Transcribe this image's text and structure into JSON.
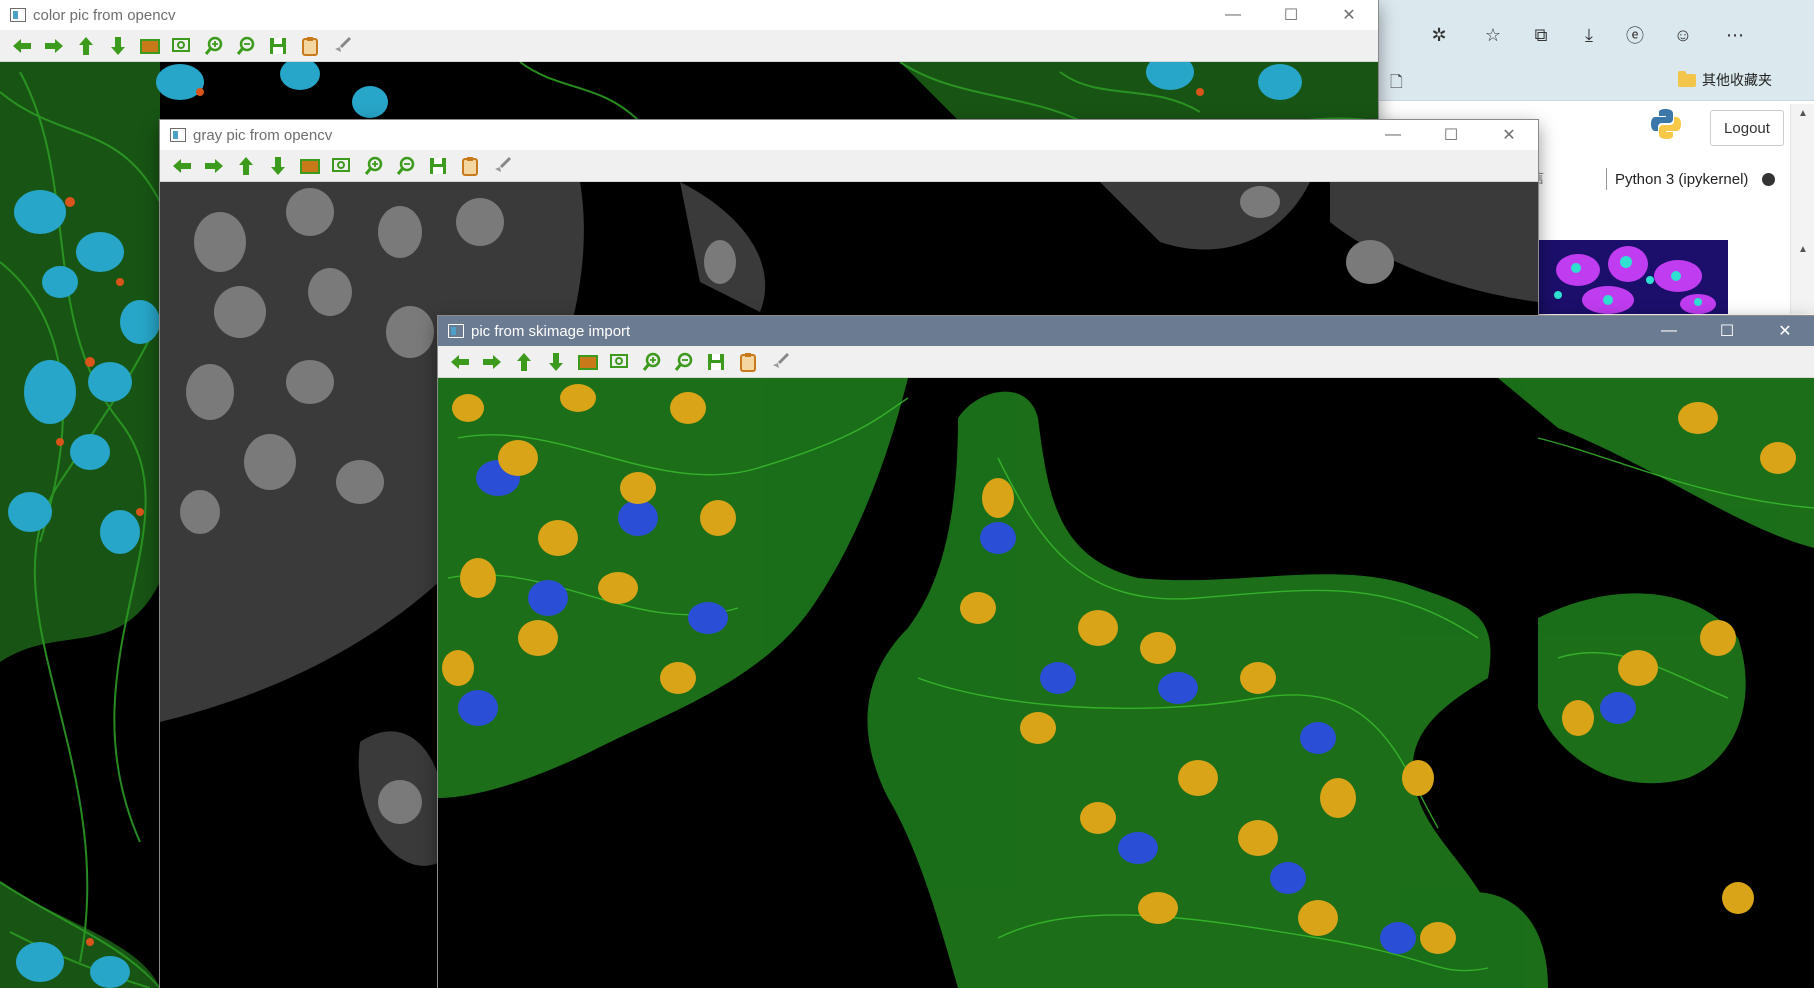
{
  "windows": {
    "color": {
      "title": "color pic from opencv"
    },
    "gray": {
      "title": "gray pic from opencv"
    },
    "skimage": {
      "title": "pic from skimage import"
    }
  },
  "window_controls": {
    "minimize": "—",
    "maximize": "☐",
    "close": "✕"
  },
  "browser": {
    "favorites_folder": "其他收藏夹",
    "logout_label": "Logout",
    "kernel_label": "Python 3 (ipykernel)",
    "partial_text": "信"
  },
  "colors": {
    "active_title": "#6b7b92",
    "toolbar_green": "#3c9a1c",
    "nucleus_blue": "#27a6c9",
    "nucleus_yellow": "#d9a418",
    "actin_green": "#2c9b24"
  }
}
